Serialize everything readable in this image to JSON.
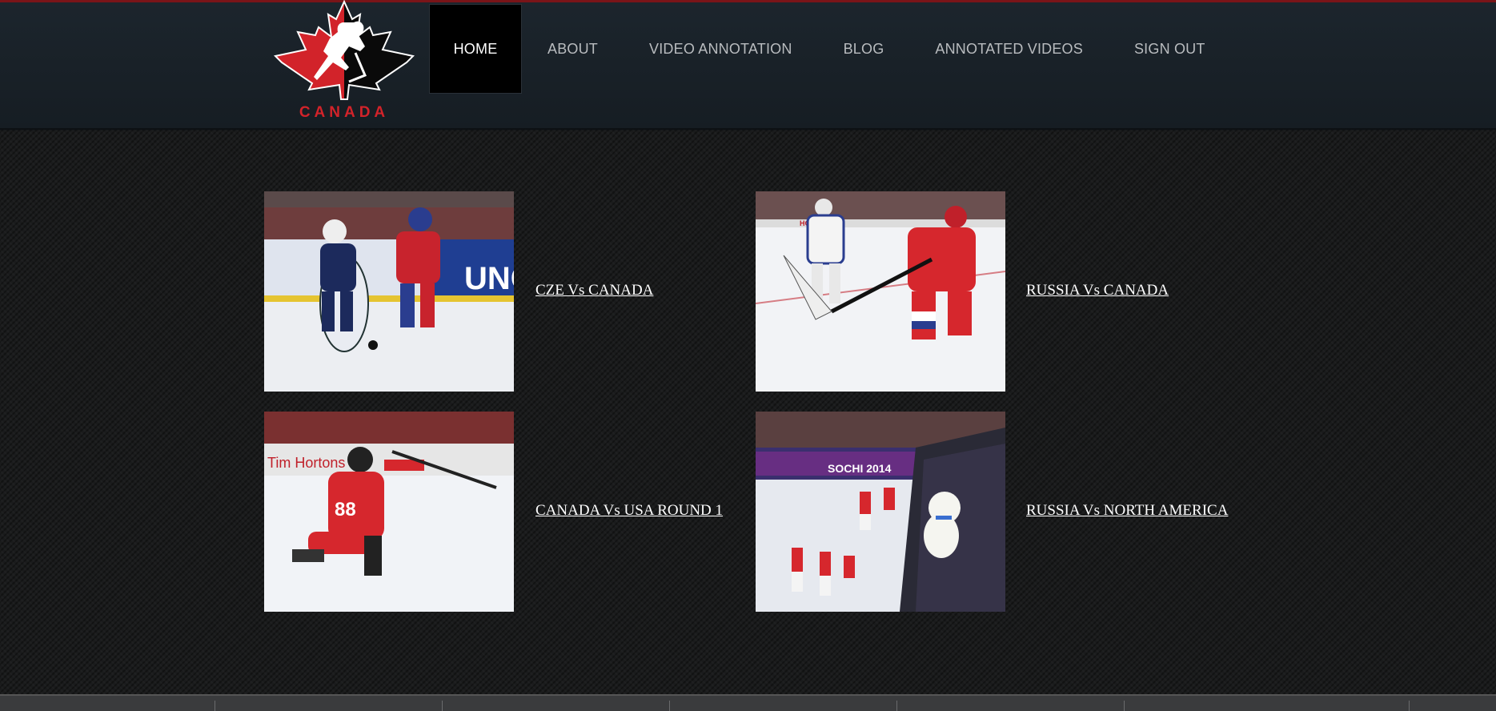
{
  "logo": {
    "text": "CANADA",
    "colors": {
      "red": "#d2232a",
      "black": "#0a0a0a"
    }
  },
  "nav": {
    "items": [
      {
        "label": "HOME",
        "active": true
      },
      {
        "label": "ABOUT"
      },
      {
        "label": "VIDEO ANNOTATION"
      },
      {
        "label": "BLOG"
      },
      {
        "label": "ANNOTATED VIDEOS"
      },
      {
        "label": "SIGN OUT"
      }
    ]
  },
  "videos": [
    {
      "title": "CZE Vs CANADA",
      "thumb_text": "UNG"
    },
    {
      "title": "RUSSIA Vs CANADA",
      "thumb_text": "HONDA"
    },
    {
      "title": "CANADA Vs USA ROUND 1",
      "thumb_text": "Tim Hortons"
    },
    {
      "title": "RUSSIA Vs NORTH AMERICA",
      "thumb_text": "SOCHI 2014"
    }
  ]
}
